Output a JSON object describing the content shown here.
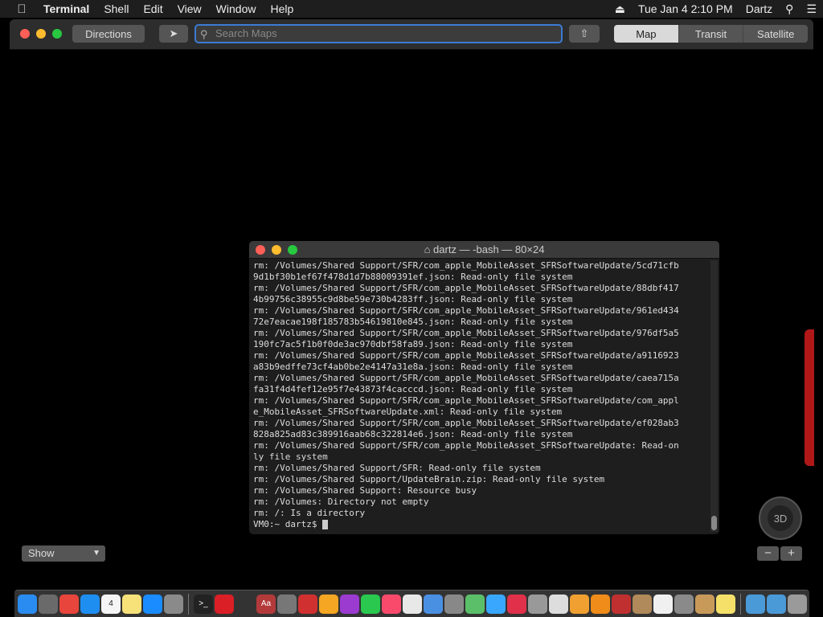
{
  "menubar": {
    "app": "Terminal",
    "items": [
      "Shell",
      "Edit",
      "View",
      "Window",
      "Help"
    ],
    "clock": "Tue Jan 4  2:10 PM",
    "user": "Dartz"
  },
  "maps": {
    "directions_label": "Directions",
    "search_placeholder": "Search Maps",
    "view_modes": [
      "Map",
      "Transit",
      "Satellite"
    ],
    "active_view": "Map",
    "show_select": "Show",
    "compass_label": "3D"
  },
  "terminal": {
    "title": "dartz — -bash — 80×24",
    "lines": [
      "rm: /Volumes/Shared Support/SFR/com_apple_MobileAsset_SFRSoftwareUpdate/5cd71cfb",
      "9d1bf30b1ef67f478d1d7b88009391ef.json: Read-only file system",
      "rm: /Volumes/Shared Support/SFR/com_apple_MobileAsset_SFRSoftwareUpdate/88dbf417",
      "4b99756c38955c9d8be59e730b4283ff.json: Read-only file system",
      "rm: /Volumes/Shared Support/SFR/com_apple_MobileAsset_SFRSoftwareUpdate/961ed434",
      "72e7eacae198f185783b54619810e845.json: Read-only file system",
      "rm: /Volumes/Shared Support/SFR/com_apple_MobileAsset_SFRSoftwareUpdate/976df5a5",
      "190fc7ac5f1b0f0de3ac970dbf58fa89.json: Read-only file system",
      "rm: /Volumes/Shared Support/SFR/com_apple_MobileAsset_SFRSoftwareUpdate/a9116923",
      "a83b9edffe73cf4ab0be2e4147a31e8a.json: Read-only file system",
      "rm: /Volumes/Shared Support/SFR/com_apple_MobileAsset_SFRSoftwareUpdate/caea715a",
      "fa31f4d4fef12e95f7e43873f4cacccd.json: Read-only file system",
      "rm: /Volumes/Shared Support/SFR/com_apple_MobileAsset_SFRSoftwareUpdate/com_appl",
      "e_MobileAsset_SFRSoftwareUpdate.xml: Read-only file system",
      "rm: /Volumes/Shared Support/SFR/com_apple_MobileAsset_SFRSoftwareUpdate/ef028ab3",
      "828a825ad83c389916aab68c322814e6.json: Read-only file system",
      "rm: /Volumes/Shared Support/SFR/com_apple_MobileAsset_SFRSoftwareUpdate: Read-on",
      "ly file system",
      "rm: /Volumes/Shared Support/SFR: Read-only file system",
      "rm: /Volumes/Shared Support/UpdateBrain.zip: Read-only file system",
      "rm: /Volumes/Shared Support: Resource busy",
      "rm: /Volumes: Directory not empty",
      "rm: /: Is a directory"
    ],
    "prompt": "VM0:~ dartz$ "
  },
  "dock": {
    "apps": [
      {
        "name": "finder-icon",
        "color": "#2a8cf0",
        "glyph": ""
      },
      {
        "name": "launchpad-icon",
        "color": "#6a6a6a",
        "glyph": ""
      },
      {
        "name": "chrome-icon",
        "color": "#e8453c",
        "glyph": ""
      },
      {
        "name": "safari-icon",
        "color": "#1f8ef1",
        "glyph": ""
      },
      {
        "name": "calendar-icon",
        "color": "#f5f5f5",
        "glyph": "4"
      },
      {
        "name": "notes-icon",
        "color": "#f7e27a",
        "glyph": ""
      },
      {
        "name": "app-store-icon",
        "color": "#1a8cff",
        "glyph": ""
      },
      {
        "name": "system-preferences-icon",
        "color": "#8a8a8a",
        "glyph": ""
      },
      {
        "name": "terminal-icon",
        "color": "#222222",
        "glyph": ">_"
      },
      {
        "name": "creative-cloud-icon",
        "color": "#da1f26",
        "glyph": ""
      },
      {
        "name": "activity-monitor-icon",
        "color": "#333333",
        "glyph": ""
      },
      {
        "name": "dictionary-icon",
        "color": "#b33a3a",
        "glyph": "Aa"
      },
      {
        "name": "font-book-icon",
        "color": "#777777",
        "glyph": ""
      },
      {
        "name": "rosetta-icon",
        "color": "#d03030",
        "glyph": ""
      },
      {
        "name": "home-icon",
        "color": "#f5a623",
        "glyph": ""
      },
      {
        "name": "potion-icon",
        "color": "#9b3bd0",
        "glyph": ""
      },
      {
        "name": "facetime-icon",
        "color": "#2ac84f",
        "glyph": ""
      },
      {
        "name": "music-icon",
        "color": "#fa4a6b",
        "glyph": ""
      },
      {
        "name": "script-editor-icon",
        "color": "#e8e8e8",
        "glyph": ""
      },
      {
        "name": "preview-icon",
        "color": "#4a90e2",
        "glyph": ""
      },
      {
        "name": "airdrop-icon",
        "color": "#888888",
        "glyph": ""
      },
      {
        "name": "maps-icon",
        "color": "#5bbf6a",
        "glyph": ""
      },
      {
        "name": "messages-icon",
        "color": "#3aa7ff",
        "glyph": ""
      },
      {
        "name": "no-entry-icon",
        "color": "#e0304a",
        "glyph": ""
      },
      {
        "name": "disk-utility-icon",
        "color": "#999999",
        "glyph": ""
      },
      {
        "name": "chess-icon",
        "color": "#dddddd",
        "glyph": ""
      },
      {
        "name": "photos-icon",
        "color": "#f0a030",
        "glyph": ""
      },
      {
        "name": "books-icon",
        "color": "#f08c1a",
        "glyph": ""
      },
      {
        "name": "photo-booth-icon",
        "color": "#c03030",
        "glyph": ""
      },
      {
        "name": "archive-icon",
        "color": "#b08a5a",
        "glyph": ""
      },
      {
        "name": "textedit-icon",
        "color": "#f0f0f0",
        "glyph": ""
      },
      {
        "name": "automator-icon",
        "color": "#8a8a8a",
        "glyph": ""
      },
      {
        "name": "notebook-icon",
        "color": "#c89a5a",
        "glyph": ""
      },
      {
        "name": "stickies-icon",
        "color": "#f5e16a",
        "glyph": ""
      }
    ],
    "trailing": [
      {
        "name": "applications-folder-icon",
        "color": "#4a9ad8",
        "glyph": ""
      },
      {
        "name": "downloads-folder-icon",
        "color": "#4a9ad8",
        "glyph": ""
      },
      {
        "name": "trash-icon",
        "color": "#9a9a9a",
        "glyph": ""
      }
    ]
  }
}
